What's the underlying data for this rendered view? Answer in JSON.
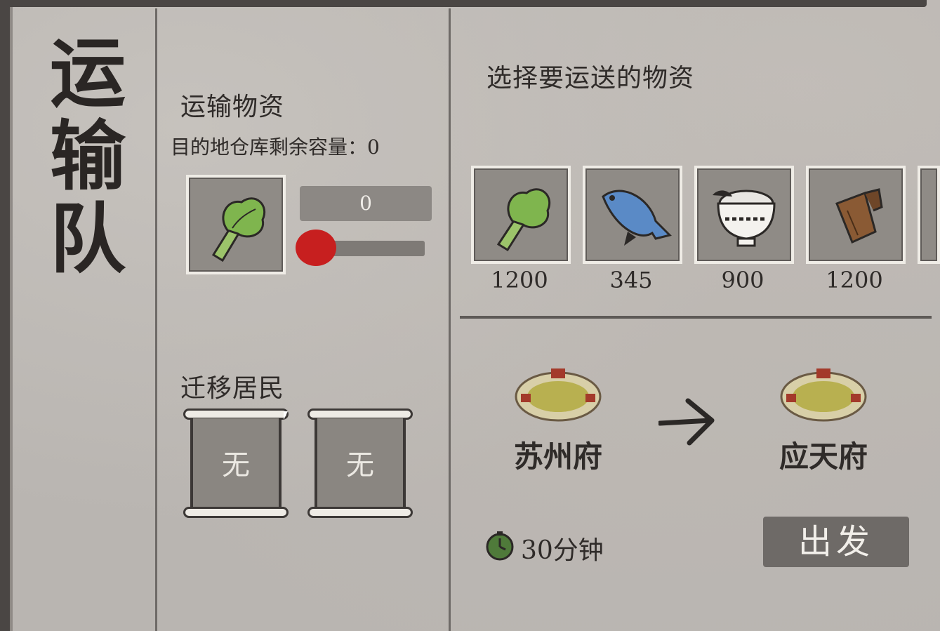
{
  "title": [
    "运",
    "输",
    "队"
  ],
  "transport": {
    "section_title": "运输物资",
    "capacity_label": "目的地仓库剩余容量：0",
    "selected_item_icon": "vegetable-icon",
    "quantity": "0",
    "slider_fraction": 0.0
  },
  "migrate": {
    "section_title": "迁移居民",
    "slots": [
      {
        "label": "无"
      },
      {
        "label": "无"
      }
    ]
  },
  "select": {
    "section_title": "选择要运送的物资",
    "items": [
      {
        "icon": "vegetable-icon",
        "count": "1200"
      },
      {
        "icon": "fish-icon",
        "count": "345"
      },
      {
        "icon": "rice-bowl-icon",
        "count": "900"
      },
      {
        "icon": "wood-icon",
        "count": "1200"
      }
    ]
  },
  "route": {
    "from": "苏州府",
    "to": "应天府",
    "duration": "30分钟",
    "depart_label": "出发"
  },
  "colors": {
    "accent_red": "#c71f1f",
    "paper": "#b9b5b1",
    "ink": "#2b2826"
  }
}
